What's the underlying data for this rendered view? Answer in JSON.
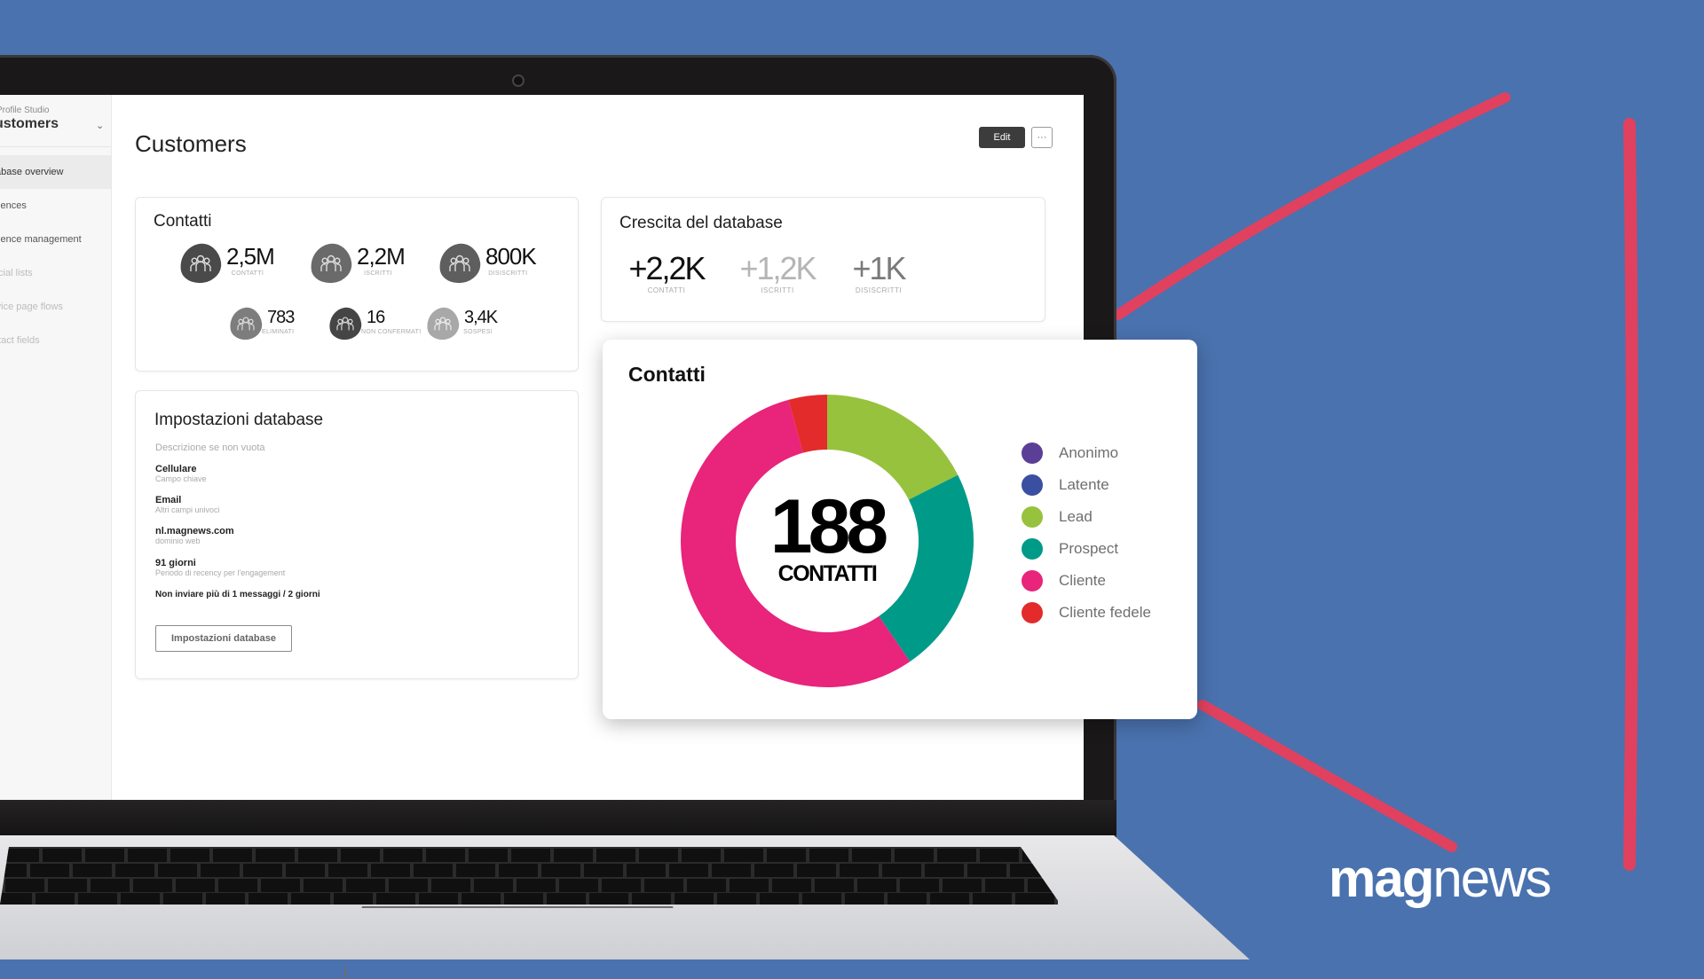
{
  "brand": {
    "logo_bold": "mag",
    "logo_light": "news"
  },
  "sidebar": {
    "app_label": "Profile Studio",
    "section_title": "ustomers",
    "items": [
      {
        "label": "tabase overview",
        "state": "active"
      },
      {
        "label": "diences",
        "state": "normal"
      },
      {
        "label": "dience management",
        "state": "normal"
      },
      {
        "label": "ecial lists",
        "state": "disabled"
      },
      {
        "label": "rvice page flows",
        "state": "disabled"
      },
      {
        "label": "ntact fields",
        "state": "disabled"
      }
    ]
  },
  "header": {
    "title": "Customers",
    "edit_label": "Edit",
    "more_label": "···"
  },
  "contacts_card": {
    "title": "Contatti",
    "stats": [
      {
        "value": "2,5M",
        "label": "CONTATTI",
        "color": "#4a4a4a"
      },
      {
        "value": "2,2M",
        "label": "ISCRITTI",
        "color": "#6a6a6a"
      },
      {
        "value": "800K",
        "label": "DISISCRITTI",
        "color": "#5e5e5e"
      },
      {
        "value": "783",
        "label": "ELIMINATI",
        "color": "#7d7d7d"
      },
      {
        "value": "16",
        "label": "NON CONFERMATI",
        "color": "#454545"
      },
      {
        "value": "3,4K",
        "label": "SOSPESI",
        "color": "#a8a8a8"
      }
    ]
  },
  "growth_card": {
    "title": "Crescita del database",
    "items": [
      {
        "value": "+2,2K",
        "label": "CONTATTI",
        "color": "#111111"
      },
      {
        "value": "+1,2K",
        "label": "ISCRITTI",
        "color": "#b5b5b5"
      },
      {
        "value": "+1K",
        "label": "DISISCRITTI",
        "color": "#7a7a7a"
      }
    ]
  },
  "settings_card": {
    "title": "Impostazioni database",
    "description": "Descrizione se non vuota",
    "rows": [
      {
        "key": "Cellulare",
        "value": "Campo chiave"
      },
      {
        "key": "Email",
        "value": "Altri campi univoci"
      },
      {
        "key": "nl.magnews.com",
        "value": "dominio web"
      },
      {
        "key": "91 giorni",
        "value": "Periodo di recency per l'engagement"
      }
    ],
    "limit_text": "Non inviare più di 1 messaggi / 2 giorni",
    "button_label": "Impostazioni database"
  },
  "donut_card": {
    "title": "Contatti",
    "total": "188",
    "unit": "CONTATTI"
  },
  "chart_data": {
    "type": "pie",
    "variant": "donut",
    "title": "Contatti",
    "center_label": "188 CONTATTI",
    "total": 188,
    "legend_position": "right",
    "categories": [
      "Anonimo",
      "Latente",
      "Lead",
      "Prospect",
      "Cliente",
      "Cliente fedele"
    ],
    "values": [
      0,
      0,
      33,
      43,
      104,
      8
    ],
    "colors": [
      "#5b3f96",
      "#3a4fa0",
      "#97c23d",
      "#009a88",
      "#e8247b",
      "#e32b2b"
    ]
  }
}
